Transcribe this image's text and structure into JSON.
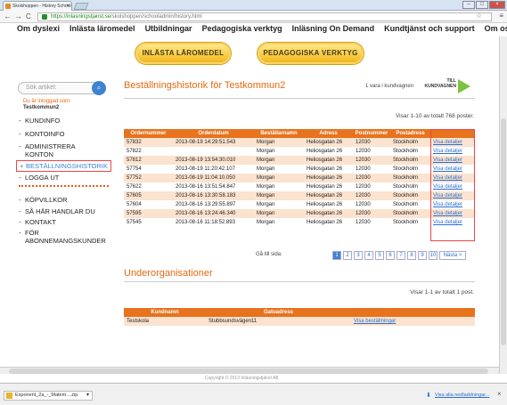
{
  "browser": {
    "tab_title": "Skolshoppen - History School",
    "close_glyph": "×",
    "url_host": "https://inlasningstjanst.se",
    "url_path": "/skolshoppen/schooladmin/history.html",
    "window_buttons": [
      "–",
      "□",
      "×"
    ],
    "nav_back": "←",
    "nav_forward": "→",
    "reload": "C",
    "star": "☆",
    "menu": "≡"
  },
  "topmenu": {
    "items": [
      "Om dyslexi",
      "Inlästa läromedel",
      "Utbildningar",
      "Pedagogiska verktyg",
      "Inläsning On Demand",
      "Kundtjänst och support",
      "Om oss"
    ]
  },
  "buttons": {
    "inlasta": "INLÄSTA LÄROMEDEL",
    "pedagogiska": "PEDAGOGISKA VERKTYG"
  },
  "sidebar": {
    "search_placeholder": "Sök artikel:",
    "search_icon": "search-icon",
    "logged_in_label": "Du är inloggad som:",
    "logged_in_name": "Testkommun2",
    "menu1": [
      {
        "label": "KUNDINFO",
        "prefix": "-"
      },
      {
        "label": "KONTOINFO",
        "prefix": "-"
      },
      {
        "label": "ADMINISTRERA",
        "prefix": "-"
      },
      {
        "label": "KONTON",
        "prefix": ""
      },
      {
        "label": "BESTÄLLNINGSHISTORIK",
        "prefix": "+"
      },
      {
        "label": "LOGGA UT",
        "prefix": "-"
      }
    ],
    "menu2": [
      {
        "label": "KÖPVILLKOR",
        "prefix": "-"
      },
      {
        "label": "SÅ HÄR HANDLAR DU",
        "prefix": "-"
      },
      {
        "label": "KONTAKT",
        "prefix": "-"
      },
      {
        "label": "FÖR",
        "prefix": "-"
      },
      {
        "label": "ABONNEMANGSKUNDER",
        "prefix": ""
      }
    ]
  },
  "main": {
    "title": "Beställningshistorik för Testkommun2",
    "cart_info": "1 vara i kundvagnen",
    "to_cart_line1": "TILL",
    "to_cart_line2": "KUNDVAGNEN",
    "visar_orders": "Visar 1-10 av totalt 768 poster.",
    "orders_headers": [
      "Ordernummer",
      "Orderdatum",
      "Beställarnamn",
      "Adress",
      "Postnummer",
      "Postadress",
      ""
    ],
    "orders": [
      [
        "57832",
        "2013-08-19 14:29:51.543",
        "Morgan",
        "Heliosgatan 26",
        "12030",
        "Stockholm",
        "Visa detaljer"
      ],
      [
        "57822",
        "",
        "Morgan",
        "Heliosgatan 26",
        "12030",
        "Stockholm",
        "Visa detaljer"
      ],
      [
        "57812",
        "2013-08-19 13:54:30.010",
        "Morgan",
        "Heliosgatan 26",
        "12030",
        "Stockholm",
        "Visa detaljer"
      ],
      [
        "57754",
        "2013-08-19 11:20:42.107",
        "Morgan",
        "Heliosgatan 26",
        "12030",
        "Stockholm",
        "Visa detaljer"
      ],
      [
        "57752",
        "2013-08-19 11:04:10.050",
        "Morgan",
        "Heliosgatan 26",
        "12030",
        "Stockholm",
        "Visa detaljer"
      ],
      [
        "57622",
        "2013-08-16 13:51:54.847",
        "Morgan",
        "Heliosgatan 26",
        "12030",
        "Stockholm",
        "Visa detaljer"
      ],
      [
        "57605",
        "2013-08-16 13:30:58.183",
        "Morgan",
        "Heliosgatan 26",
        "12030",
        "Stockholm",
        "Visa detaljer"
      ],
      [
        "57604",
        "2013-08-16 13:29:55.897",
        "Morgan",
        "Heliosgatan 26",
        "12030",
        "Stockholm",
        "Visa detaljer"
      ],
      [
        "57595",
        "2013-08-16 13:24:46.340",
        "Morgan",
        "Heliosgatan 26",
        "12030",
        "Stockholm",
        "Visa detaljer"
      ],
      [
        "57545",
        "2013-08-16 11:18:52.893",
        "Morgan",
        "Heliosgatan 26",
        "12030",
        "Stockholm",
        "Visa detaljer"
      ]
    ],
    "pager_label": "Gå till sida:",
    "pages": [
      "1",
      "2",
      "3",
      "4",
      "5",
      "6",
      "7",
      "8",
      "9",
      "10"
    ],
    "current_page": "1",
    "next_label": "Nästa >",
    "sub_title": "Underorganisationer",
    "visar_units": "Visar 1-1 av totalt 1 post.",
    "units_headers": [
      "Kundnamn",
      "Gatuadress",
      ""
    ],
    "units": [
      [
        "Testskola",
        "Stubbsundsvägen11",
        "Visa beställningar"
      ]
    ]
  },
  "footer": {
    "text": "Copyright © 2013 Inläsningstjänst AB"
  },
  "downloads": {
    "file": "Exponent_2a_-_Matem....zip",
    "show_all": "Visa alla nedladdningar...",
    "close": "×"
  }
}
